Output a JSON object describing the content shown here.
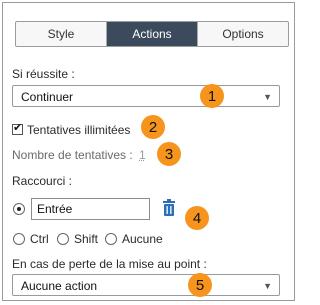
{
  "tabs": {
    "style": "Style",
    "actions": "Actions",
    "options": "Options"
  },
  "on_success": {
    "label": "Si réussite :",
    "selected": "Continuer"
  },
  "unlimited_attempts": {
    "label": "Tentatives illimitées",
    "checked": true
  },
  "attempts": {
    "label": "Nombre de tentatives :",
    "value": "1"
  },
  "shortcut": {
    "label": "Raccourci :",
    "key_value": "Entrée",
    "modifiers": {
      "ctrl": "Ctrl",
      "shift": "Shift",
      "none": "Aucune"
    }
  },
  "focus_lost": {
    "label": "En cas de perte de la mise au point :",
    "selected": "Aucune action"
  },
  "callouts": {
    "b1": "1",
    "b2": "2",
    "b3": "3",
    "b4": "4",
    "b5": "5"
  },
  "colors": {
    "active_tab": "#3b4a5c",
    "callout": "#f7941d",
    "trash": "#2b6fb8"
  }
}
